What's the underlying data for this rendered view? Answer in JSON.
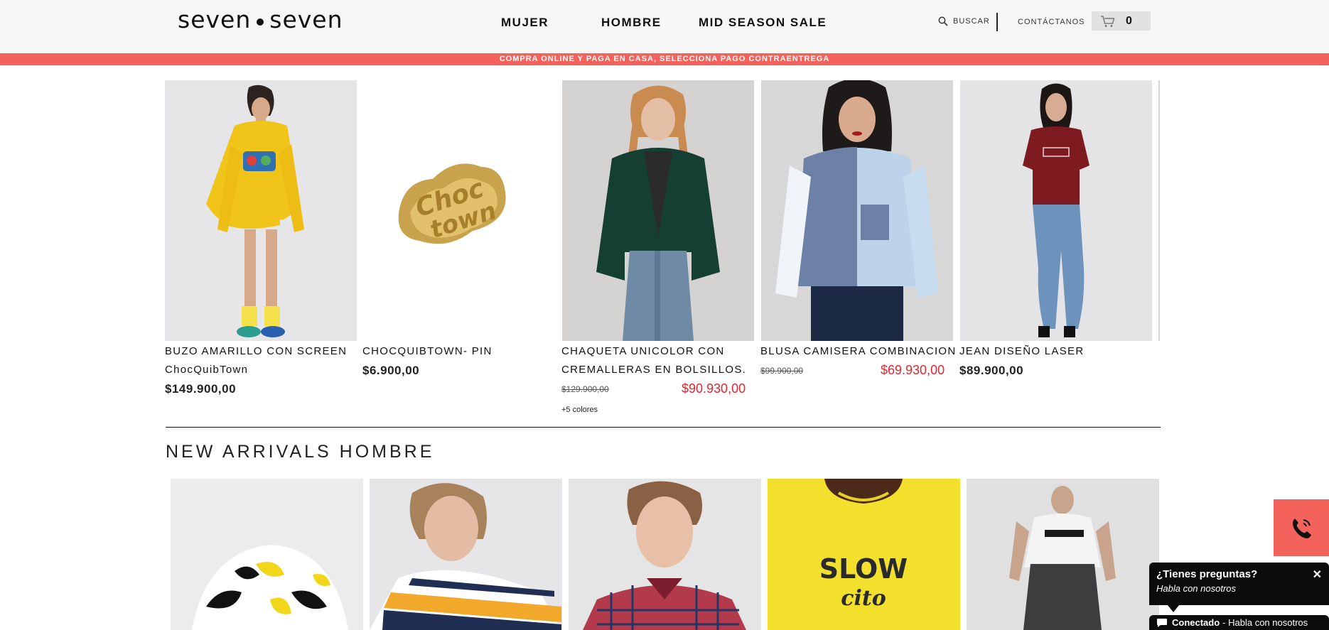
{
  "header": {
    "logo_left": "seven",
    "logo_right": "seven",
    "nav": [
      "MUJER",
      "HOMBRE",
      "MID SEASON SALE"
    ],
    "search_label": "BUSCAR",
    "contact_label": "CONTÁCTANOS",
    "cart_count": "0"
  },
  "promo": "COMPRA ONLINE Y PAGA EN CASA, SELECCIONA PAGO CONTRAENTREGA",
  "products": [
    {
      "title": "BUZO AMARILLO CON SCREEN",
      "title2": "ChocQuibTown",
      "price": "$149.900,00"
    },
    {
      "title": "CHOCQUIBTOWN- PIN",
      "price": "$6.900,00"
    },
    {
      "title": "CHAQUETA UNICOLOR CON",
      "title2": "CREMALLERAS EN BOLSILLOS.",
      "old_price": "$129.900,00",
      "sale_price": "$90.930,00",
      "colors": "+5 colores"
    },
    {
      "title": "BLUSA CAMISERA COMBINACION",
      "old_price": "$99.900,00",
      "sale_price": "$69.930,00"
    },
    {
      "title": "JEAN DISEÑO LASER",
      "price": "$89.900,00"
    }
  ],
  "section": {
    "title": "NEW ARRIVALS HOMBRE"
  },
  "new_arrivals": [
    {
      "shirt_text": ""
    },
    {
      "shirt_text": ""
    },
    {
      "shirt_text": ""
    },
    {
      "shirt_text": "SLOW",
      "shirt_text2": "cito"
    },
    {
      "shirt_text": ""
    }
  ],
  "chat": {
    "question": "¿Tienes preguntas?",
    "subtitle": "Habla con nosotros",
    "close": "✕",
    "status": "Conectado",
    "status_sub": "- Habla con nosotros"
  },
  "colors": {
    "accent": "#f3625b",
    "sale": "#e5252e"
  }
}
